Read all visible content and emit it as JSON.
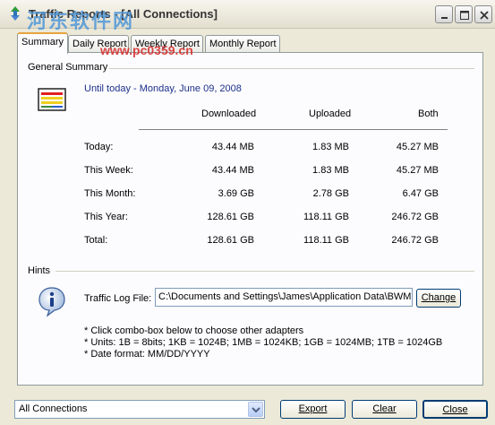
{
  "window": {
    "title": "Traffic Reports - [All Connections]"
  },
  "watermark": {
    "text_cn": "河东软件网",
    "url": "www.pc0359.cn"
  },
  "tabs": [
    {
      "label": "Summary",
      "active": true
    },
    {
      "label": "Daily Report",
      "active": false
    },
    {
      "label": "Weekly Report",
      "active": false
    },
    {
      "label": "Monthly Report",
      "active": false
    }
  ],
  "summary": {
    "group_label": "General Summary",
    "date_label": "Until today - Monday, June 09, 2008",
    "columns": [
      "Downloaded",
      "Uploaded",
      "Both"
    ],
    "rows": [
      {
        "label": "Today:",
        "downloaded": "43.44 MB",
        "uploaded": "1.83 MB",
        "both": "45.27 MB"
      },
      {
        "label": "This Week:",
        "downloaded": "43.44 MB",
        "uploaded": "1.83 MB",
        "both": "45.27 MB"
      },
      {
        "label": "This Month:",
        "downloaded": "3.69 GB",
        "uploaded": "2.78 GB",
        "both": "6.47 GB"
      },
      {
        "label": "This Year:",
        "downloaded": "128.61 GB",
        "uploaded": "118.11 GB",
        "both": "246.72 GB"
      },
      {
        "label": "Total:",
        "downloaded": "128.61 GB",
        "uploaded": "118.11 GB",
        "both": "246.72 GB"
      }
    ]
  },
  "hints": {
    "group_label": "Hints",
    "log_file_label": "Traffic Log File:",
    "log_file_value": "C:\\Documents and Settings\\James\\Application Data\\BWMon",
    "change_button": "Change",
    "lines": [
      "* Click combo-box below to choose other adapters",
      "* Units: 1B = 8bits; 1KB = 1024B; 1MB = 1024KB; 1GB = 1024MB; 1TB = 1024GB",
      "* Date format: MM/DD/YYYY"
    ]
  },
  "footer": {
    "adapter_selected": "All Connections",
    "export_button": "Export",
    "clear_button": "Clear",
    "close_button": "Close"
  },
  "icons": {
    "app": "app-icon",
    "summary": "calendar-chart-icon",
    "hints": "info-icon",
    "minimize": "minimize-icon",
    "maximize": "maximize-icon",
    "close": "close-icon",
    "dropdown": "chevron-down-icon"
  },
  "colors": {
    "date_label": "#1c2f8a",
    "active_tab_accent": "#e8a33f",
    "window_bg": "#ece9d8"
  }
}
